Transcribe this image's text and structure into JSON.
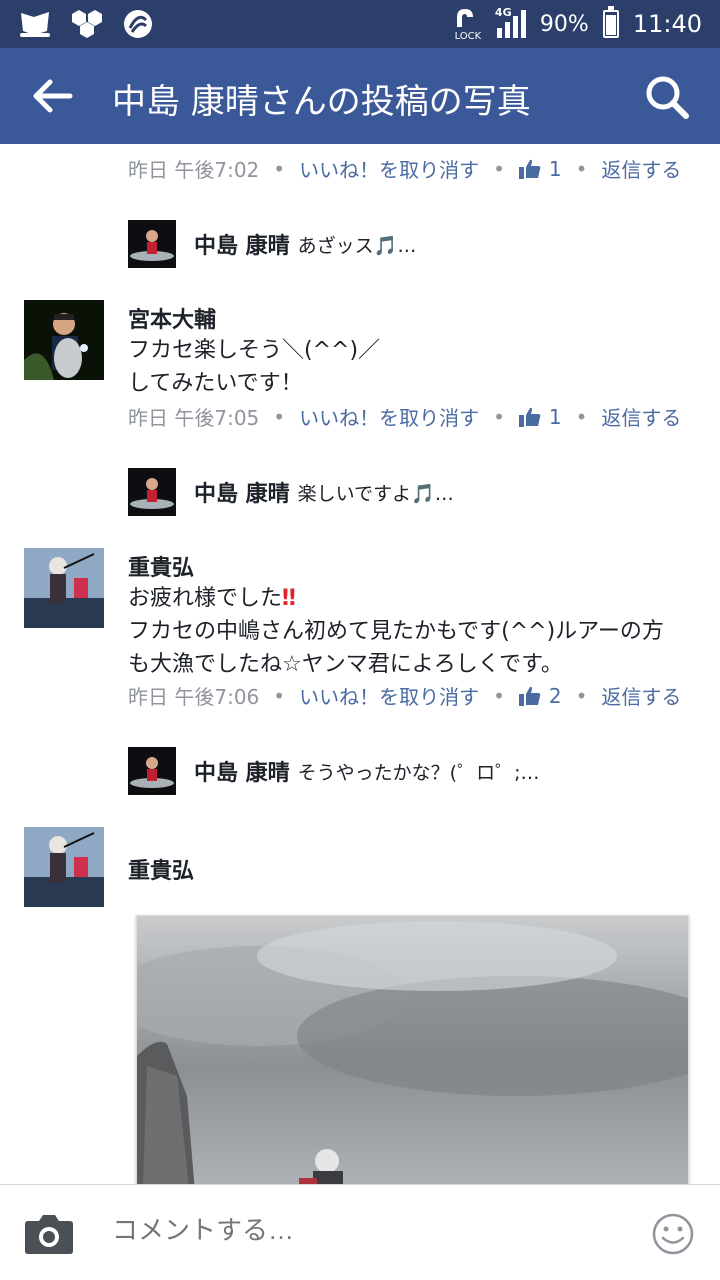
{
  "status_bar": {
    "battery": "90%",
    "time": "11:40",
    "network": "4G",
    "lock_label": "LOCK",
    "battery_level": 0.9
  },
  "header": {
    "title": "中島 康晴さんの投稿の写真"
  },
  "comments": [
    {
      "meta": {
        "time": "昨日 午後7:02",
        "unlike": "いいね！を取り消す",
        "likes": "1",
        "reply": "返信する"
      }
    },
    {
      "reply_preview": {
        "name": "中島 康晴",
        "text": "あざッス🎵…"
      }
    },
    {
      "author": "宮本大輔",
      "text_lines": [
        "フカセ楽しそう＼(^^)／",
        "してみたいです！"
      ],
      "meta": {
        "time": "昨日 午後7:05",
        "unlike": "いいね！を取り消す",
        "likes": "1",
        "reply": "返信する"
      }
    },
    {
      "reply_preview": {
        "name": "中島 康晴",
        "text": "楽しいですよ🎵…"
      }
    },
    {
      "author": "重貴弘",
      "text_lines": [
        "お疲れ様でした‼",
        "フカセの中嶋さん初めて見たかもです(^^)ルアーの方",
        "も大漁でしたね☆ヤンマ君によろしくです。"
      ],
      "meta": {
        "time": "昨日 午後7:06",
        "unlike": "いいね！を取り消す",
        "likes": "2",
        "reply": "返信する"
      }
    },
    {
      "reply_preview": {
        "name": "中島 康晴",
        "text": "そうやったかな？(゜ロ゜;…"
      }
    },
    {
      "author": "重貴弘"
    }
  ],
  "composer": {
    "placeholder": "コメントする…"
  },
  "colors": {
    "status_bar": "#2c3f6b",
    "app_bar": "#3b5998",
    "link": "#4b6ba3",
    "meta_gray": "#90949c",
    "exclaim_red": "#e0242c"
  },
  "icons": [
    "back-arrow-icon",
    "search-icon",
    "thumbs-up-icon",
    "camera-icon",
    "smiley-icon"
  ]
}
